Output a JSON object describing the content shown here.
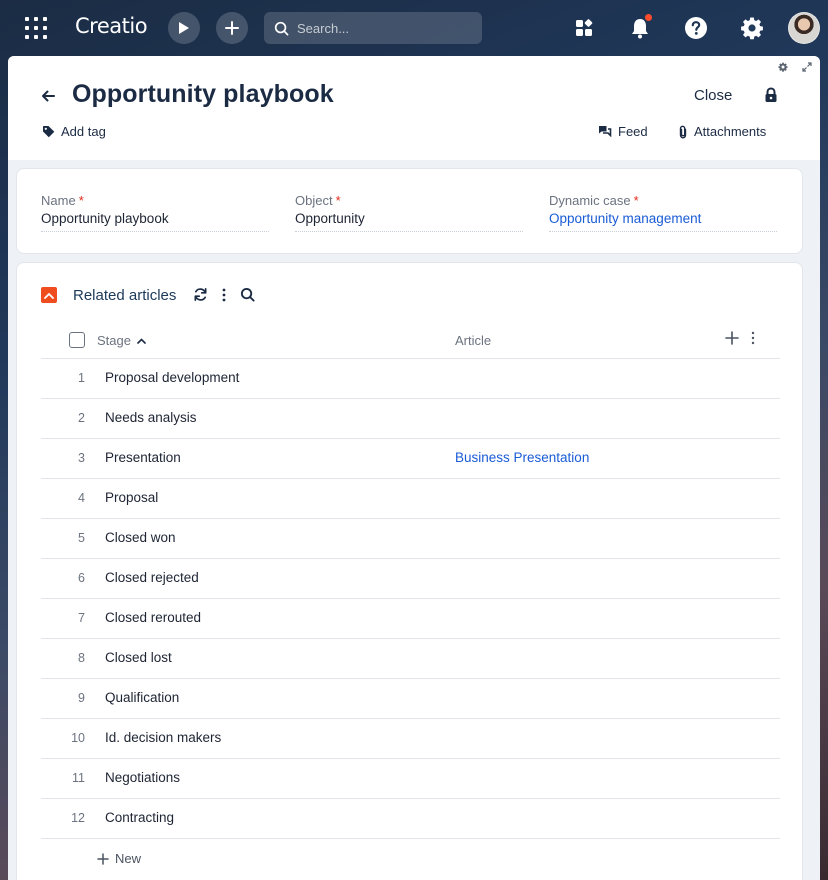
{
  "topbar": {
    "logo": "Creatio",
    "search_placeholder": "Search..."
  },
  "header": {
    "title": "Opportunity playbook",
    "close_label": "Close",
    "add_tag_label": "Add tag",
    "feed_label": "Feed",
    "attachments_label": "Attachments"
  },
  "fields": {
    "name": {
      "label": "Name",
      "required": "*",
      "value": "Opportunity playbook"
    },
    "object": {
      "label": "Object",
      "required": "*",
      "value": "Opportunity"
    },
    "dynamic_case": {
      "label": "Dynamic case",
      "required": "*",
      "value": "Opportunity management"
    }
  },
  "list": {
    "title": "Related articles",
    "columns": {
      "stage": "Stage",
      "article": "Article"
    },
    "rows": [
      {
        "num": "1",
        "stage": "Proposal development",
        "article": ""
      },
      {
        "num": "2",
        "stage": "Needs analysis",
        "article": ""
      },
      {
        "num": "3",
        "stage": "Presentation",
        "article": "Business Presentation"
      },
      {
        "num": "4",
        "stage": "Proposal",
        "article": ""
      },
      {
        "num": "5",
        "stage": "Closed won",
        "article": ""
      },
      {
        "num": "6",
        "stage": "Closed rejected",
        "article": ""
      },
      {
        "num": "7",
        "stage": "Closed rerouted",
        "article": ""
      },
      {
        "num": "8",
        "stage": "Closed lost",
        "article": ""
      },
      {
        "num": "9",
        "stage": "Qualification",
        "article": ""
      },
      {
        "num": "10",
        "stage": "Id. decision makers",
        "article": ""
      },
      {
        "num": "11",
        "stage": "Negotiations",
        "article": ""
      },
      {
        "num": "12",
        "stage": "Contracting",
        "article": ""
      }
    ],
    "new_label": "New"
  },
  "colors": {
    "accent_orange": "#f04d1f",
    "link_blue": "#1a5bd6",
    "notification_dot": "#ff4c2c",
    "required_red": "#e02a1a"
  },
  "icons": [
    "apps-grid-icon",
    "play-icon",
    "plus-icon",
    "search-icon",
    "widgets-icon",
    "bell-icon",
    "help-icon",
    "gear-icon",
    "back-arrow-icon",
    "lock-icon",
    "tag-icon",
    "feed-icon",
    "paperclip-icon",
    "chevron-up-icon",
    "refresh-icon",
    "more-vertical-icon",
    "sort-asc-icon"
  ]
}
